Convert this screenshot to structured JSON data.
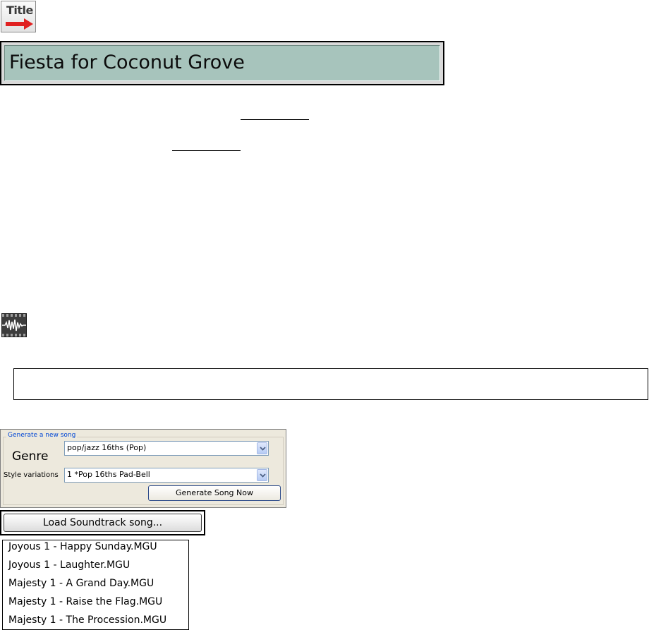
{
  "title_icon": {
    "text": "Title",
    "icon": "title-arrow-icon",
    "arrow_color": "#e02020"
  },
  "title_banner": {
    "text": "Fiesta for Coconut Grove",
    "background": "#a7c4bc"
  },
  "wave_icon": {
    "icon": "audio-waveform-icon"
  },
  "generate_panel": {
    "legend": "Generate a new song",
    "genre_label": "Genre",
    "genre_value": "pop/jazz 16ths (Pop)",
    "style_variations_label": "Style variations",
    "style_variation_value": "1 *Pop 16ths Pad-Bell",
    "generate_button": "Generate Song Now"
  },
  "load_button": "Load Soundtrack song...",
  "file_list": [
    "Joyous 1 - Happy Sunday.MGU",
    "Joyous 1 - Laughter.MGU",
    "Majesty 1 - A Grand Day.MGU",
    "Majesty 1 - Raise the Flag.MGU",
    "Majesty 1 - The Procession.MGU"
  ]
}
